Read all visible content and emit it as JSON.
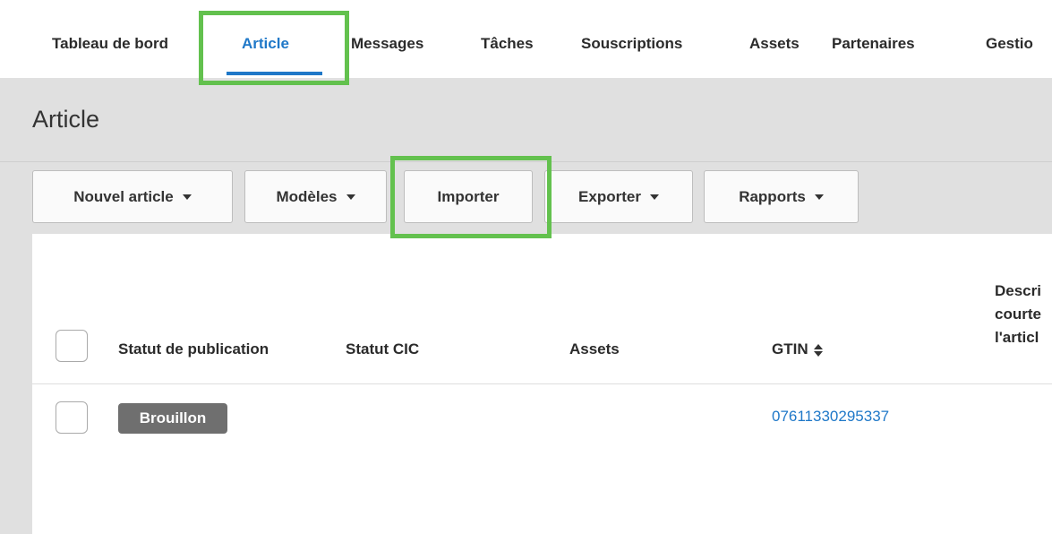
{
  "nav": {
    "items": [
      {
        "label": "Tableau de bord",
        "active": false
      },
      {
        "label": "Article",
        "active": true
      },
      {
        "label": "Messages",
        "active": false
      },
      {
        "label": "Tâches",
        "active": false
      },
      {
        "label": "Souscriptions",
        "active": false
      },
      {
        "label": "Assets",
        "active": false
      },
      {
        "label": "Partenaires",
        "active": false
      },
      {
        "label": "Gestio",
        "active": false
      }
    ]
  },
  "page": {
    "title": "Article"
  },
  "toolbar": {
    "new_article": "Nouvel article",
    "templates": "Modèles",
    "import": "Importer",
    "export": "Exporter",
    "reports": "Rapports"
  },
  "table": {
    "headers": {
      "publication_status": "Statut de publication",
      "cic_status": "Statut CIC",
      "assets": "Assets",
      "gtin": "GTIN",
      "description_line1": "Descri",
      "description_line2": "courte",
      "description_line3": "l'articl"
    },
    "rows": [
      {
        "status": "Brouillon",
        "gtin": "07611330295337"
      }
    ]
  },
  "colors": {
    "accent": "#1f78c8",
    "highlight": "#63c14e",
    "band": "#e0e0e0",
    "badge": "#6f6f6f"
  }
}
